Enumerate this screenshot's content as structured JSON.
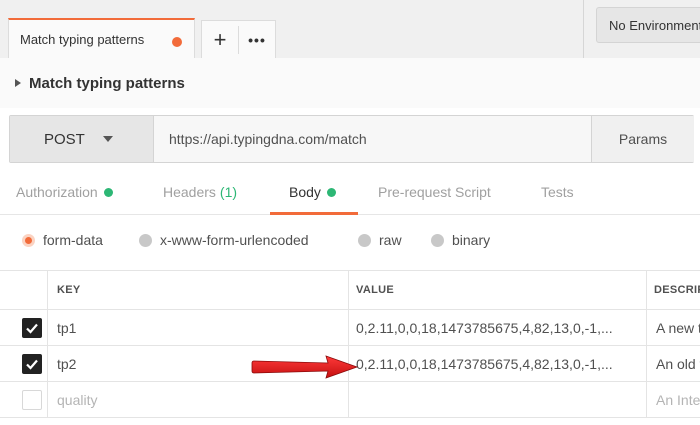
{
  "tabs": {
    "active_label": "Match typing patterns",
    "add_glyph": "+",
    "more_glyph": "•••"
  },
  "environment": {
    "selected": "No Environment"
  },
  "request": {
    "name": "Match typing patterns",
    "method": "POST",
    "url": "https://api.typingdna.com/match",
    "params_label": "Params"
  },
  "subtabs": {
    "authorization": "Authorization",
    "headers": "Headers",
    "headers_count": "(1)",
    "body": "Body",
    "prerequest": "Pre-request Script",
    "tests": "Tests",
    "active": "Body"
  },
  "body_types": {
    "form_data": "form-data",
    "urlencoded": "x-www-form-urlencoded",
    "raw": "raw",
    "binary": "binary",
    "selected": "form-data"
  },
  "table": {
    "headers": {
      "key": "KEY",
      "value": "VALUE",
      "description": "DESCRIPTION"
    },
    "rows": [
      {
        "checked": true,
        "key": "tp1",
        "value": "0,2.11,0,0,18,1473785675,4,82,13,0,-1,...",
        "description": "A new typing pattern"
      },
      {
        "checked": true,
        "key": "tp2",
        "value": "0,2.11,0,0,18,1473785675,4,82,13,0,-1,...",
        "description": "An old typing pattern"
      },
      {
        "checked": false,
        "key": "quality",
        "value": "",
        "description": "An Integer"
      }
    ]
  },
  "colors": {
    "accent_orange": "#f26b3a",
    "status_green": "#2db775",
    "arrow_red": "#e01a1a"
  }
}
